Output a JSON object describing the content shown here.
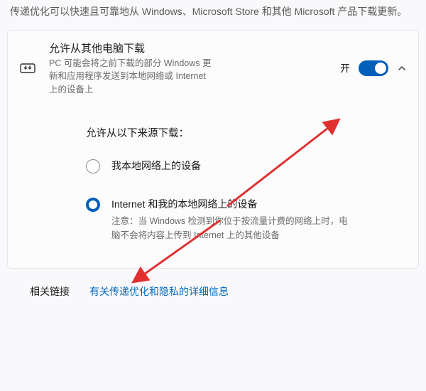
{
  "intro": "传递优化可以快速且可靠地从 Windows、Microsoft Store 和其他 Microsoft 产品下载更新。",
  "header": {
    "title": "允许从其他电脑下载",
    "desc": "PC 可能会将之前下载的部分 Windows 更新和应用程序发送到本地网络或 Internet 上的设备上",
    "toggle_state": "开"
  },
  "section": {
    "title": "允许从以下来源下载：",
    "options": [
      {
        "label": "我本地网络上的设备",
        "selected": false
      },
      {
        "label": "Internet 和我的本地网络上的设备",
        "note": "注意：当 Windows 检测到你位于按流量计费的网络上时，电脑不会将内容上传到 Internet 上的其他设备",
        "selected": true
      }
    ]
  },
  "links": {
    "label": "相关链接",
    "link_text": "有关传递优化和隐私的详细信息"
  }
}
